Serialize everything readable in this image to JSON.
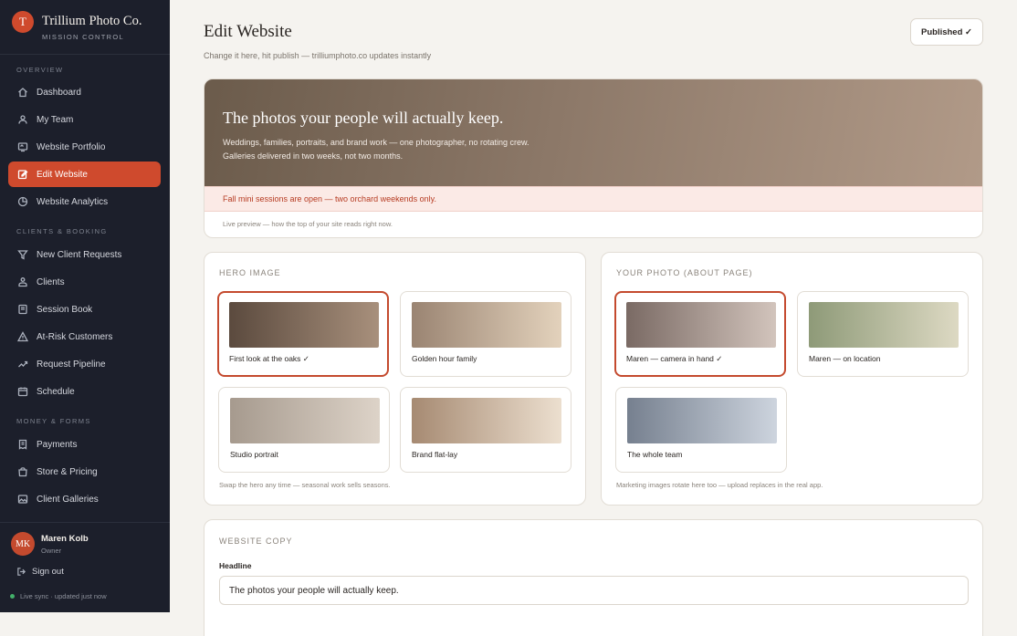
{
  "brand": {
    "logo_letter": "T",
    "name": "Trillium Photo Co.",
    "subtitle": "MISSION CONTROL"
  },
  "sidebar": {
    "sections": [
      {
        "title": "OVERVIEW",
        "items": [
          {
            "label": "Dashboard",
            "icon": "home-icon"
          },
          {
            "label": "My Team",
            "icon": "users-icon"
          },
          {
            "label": "Website Portfolio",
            "icon": "portfolio-icon"
          },
          {
            "label": "Edit Website",
            "icon": "edit-icon",
            "active": true
          },
          {
            "label": "Website Analytics",
            "icon": "analytics-icon"
          }
        ]
      },
      {
        "title": "CLIENTS & BOOKING",
        "items": [
          {
            "label": "New Client Requests",
            "icon": "filter-icon"
          },
          {
            "label": "Clients",
            "icon": "clients-icon"
          },
          {
            "label": "Session Book",
            "icon": "book-icon"
          },
          {
            "label": "At-Risk Customers",
            "icon": "warning-icon"
          },
          {
            "label": "Request Pipeline",
            "icon": "trend-icon"
          },
          {
            "label": "Schedule",
            "icon": "calendar-icon"
          }
        ]
      },
      {
        "title": "MONEY & FORMS",
        "items": [
          {
            "label": "Payments",
            "icon": "receipt-icon"
          },
          {
            "label": "Store & Pricing",
            "icon": "bag-icon"
          },
          {
            "label": "Client Galleries",
            "icon": "gallery-icon"
          }
        ]
      }
    ],
    "user": {
      "initials": "MK",
      "name": "Maren Kolb",
      "role": "Owner"
    },
    "signout_label": "Sign out",
    "sync_status": "Live sync · updated just now"
  },
  "header": {
    "title": "Edit Website",
    "subtitle": "Change it here, hit publish — trilliumphoto.co updates instantly",
    "publish_label": "Published ✓"
  },
  "preview": {
    "headline": "The photos your people will actually keep.",
    "description_line1": "Weddings, families, portraits, and brand work — one photographer, no rotating crew.",
    "description_line2": "Galleries delivered in two weeks, not two months.",
    "notice": "Fall mini sessions are open — two orchard weekends only.",
    "note": "Live preview — how the top of your site reads right now."
  },
  "hero_image": {
    "label": "HERO IMAGE",
    "options": [
      {
        "caption": "First look at the oaks ✓",
        "selected": true,
        "gradient": [
          "#5b4a3e",
          "#a8907c"
        ]
      },
      {
        "caption": "Golden hour family",
        "selected": false,
        "gradient": [
          "#9a8472",
          "#e3d2bc"
        ]
      },
      {
        "caption": "Studio portrait",
        "selected": false,
        "gradient": [
          "#a69a8e",
          "#ddd3c8"
        ]
      },
      {
        "caption": "Brand flat-lay",
        "selected": false,
        "gradient": [
          "#a68a72",
          "#ecdfcf"
        ]
      }
    ],
    "footer": "Swap the hero any time — seasonal work sells seasons."
  },
  "about_photo": {
    "label": "YOUR PHOTO (ABOUT PAGE)",
    "options": [
      {
        "caption": "Maren — camera in hand ✓",
        "selected": true,
        "gradient": [
          "#7a6a64",
          "#d2c4bc"
        ]
      },
      {
        "caption": "Maren — on location",
        "selected": false,
        "gradient": [
          "#8e9a78",
          "#ddd9c3"
        ]
      },
      {
        "caption": "The whole team",
        "selected": false,
        "gradient": [
          "#76808f",
          "#cdd4de"
        ]
      }
    ],
    "footer": "Marketing images rotate here too — upload replaces in the real app."
  },
  "website_copy": {
    "label": "WEBSITE COPY",
    "headline_label": "Headline",
    "headline_value": "The photos your people will actually keep."
  }
}
